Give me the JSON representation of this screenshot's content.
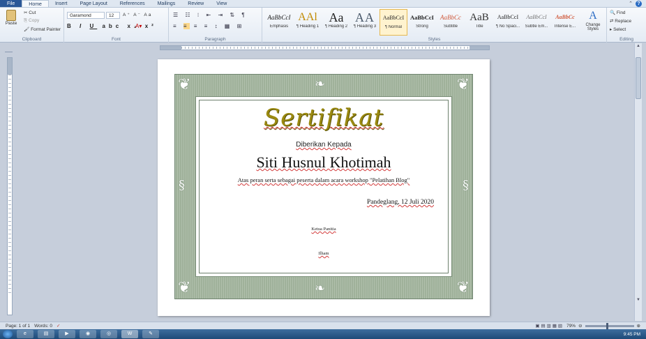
{
  "tabs": [
    "File",
    "Home",
    "Insert",
    "Page Layout",
    "References",
    "Mailings",
    "Review",
    "View"
  ],
  "active_tab": "Home",
  "clipboard": {
    "paste": "Paste",
    "cut": "Cut",
    "copy": "Copy",
    "format_painter": "Format Painter",
    "label": "Clipboard"
  },
  "font": {
    "name": "Garamond",
    "size": "12",
    "label": "Font"
  },
  "paragraph": {
    "label": "Paragraph"
  },
  "styles": {
    "label": "Styles",
    "items": [
      {
        "sample": "AaBbCcI",
        "name": "Emphasis"
      },
      {
        "sample": "AAl",
        "name": "¶ Heading 1"
      },
      {
        "sample": "Aa",
        "name": "¶ Heading 2"
      },
      {
        "sample": "AA",
        "name": "¶ Heading 3"
      },
      {
        "sample": "AaBbCcI",
        "name": "¶ Normal"
      },
      {
        "sample": "AaBbCcI",
        "name": "Strong"
      },
      {
        "sample": "AaBbCc",
        "name": "Subtitle"
      },
      {
        "sample": "AaB",
        "name": "Title"
      },
      {
        "sample": "AaBbCcI",
        "name": "¶ No Spaci..."
      },
      {
        "sample": "AaBbCcI",
        "name": "Subtle Em..."
      },
      {
        "sample": "AaBbCc",
        "name": "Intense E..."
      }
    ],
    "change_styles": "Change Styles"
  },
  "editing": {
    "find": "Find",
    "replace": "Replace",
    "select": "Select",
    "label": "Editing"
  },
  "document": {
    "title": "Sertifikat",
    "given": "Diberikan Kepada",
    "name": "Siti Husnul Khotimah",
    "desc": "Atas peran serta sebagai peserta dalam acara workshop \"Pelatihan Blog\"",
    "place": "Pandeglang, 12 Juli 2020",
    "chair": "Ketua Panitia",
    "sign": "Ilham"
  },
  "status": {
    "page": "Page: 1 of 1",
    "words": "Words: 0",
    "zoom": "79%"
  },
  "clock": "9:45 PM",
  "colors": {
    "title_gold": "#9b8a10",
    "frame_green": "#9fb19a",
    "ribbon_blue": "#2b5797"
  }
}
